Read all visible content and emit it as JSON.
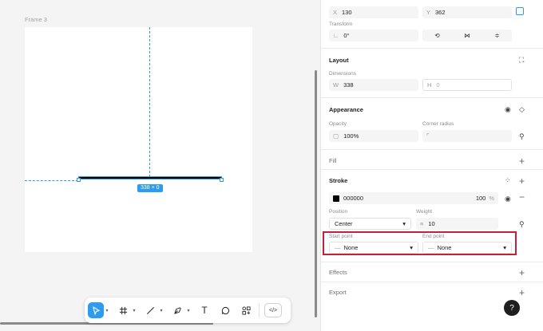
{
  "canvas": {
    "frame_label": "Frame 3",
    "size_badge": "338 × 0"
  },
  "toolbar": {
    "tools": [
      "move",
      "frame",
      "line",
      "pen",
      "text",
      "comment",
      "components"
    ],
    "text_glyph": "T",
    "code_glyph": "</>"
  },
  "panel": {
    "position": {
      "x_label": "X",
      "x_value": "130",
      "y_label": "Y",
      "y_value": "362"
    },
    "transform": {
      "label": "Transform",
      "rotation": "0°"
    },
    "layout": {
      "title": "Layout",
      "dimensions_label": "Dimensions",
      "w_label": "W",
      "w_value": "338",
      "h_label": "H",
      "h_value": "0"
    },
    "appearance": {
      "title": "Appearance",
      "opacity_label": "Opacity",
      "opacity_value": "100%",
      "radius_label": "Corner radius",
      "radius_value": ""
    },
    "fill": {
      "title": "Fill"
    },
    "stroke": {
      "title": "Stroke",
      "color_hex": "000000",
      "swatch_color": "#000000",
      "opacity_value": "100",
      "opacity_unit": "%",
      "position_label": "Position",
      "position_value": "Center",
      "weight_label": "Weight",
      "weight_value": "10",
      "start_label": "Start point",
      "start_value": "None",
      "end_label": "End point",
      "end_value": "None"
    },
    "effects": {
      "title": "Effects"
    },
    "export": {
      "title": "Export"
    },
    "help": "?"
  },
  "colors": {
    "accent": "#2c9bf0",
    "highlight": "#c4203c"
  }
}
